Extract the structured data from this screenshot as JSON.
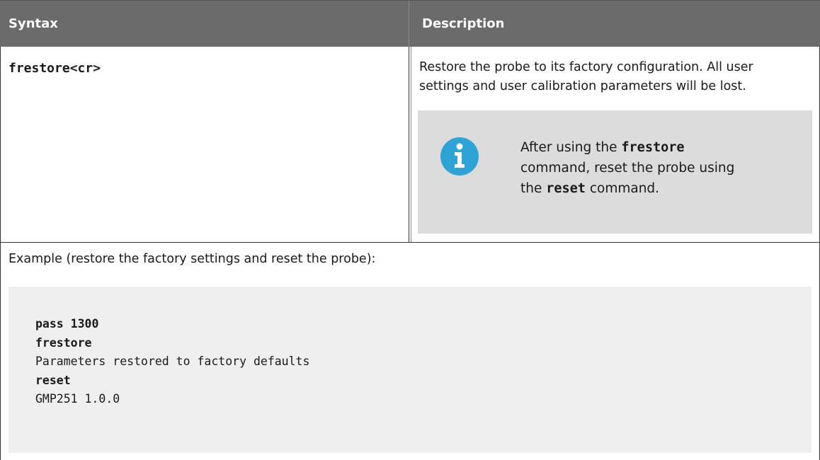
{
  "table": {
    "header": {
      "syntax": "Syntax",
      "description": "Description"
    },
    "row1": {
      "syntax_command": "frestore<cr>",
      "description_line1": "Restore the probe to its factory configuration. All user",
      "description_line2": "settings and user calibration parameters will be lost.",
      "note": {
        "icon": "info-icon",
        "line1_prefix": "After using the ",
        "line1_code": "frestore",
        "line2": "command, reset the probe using",
        "line3_prefix": "the ",
        "line3_code": "reset",
        "line3_suffix": " command."
      }
    },
    "row2": {
      "example_label": "Example (restore the factory settings and reset the probe):",
      "code_lines": [
        {
          "text": "pass 1300",
          "bold": true
        },
        {
          "text": "frestore",
          "bold": true
        },
        {
          "text": "Parameters restored to factory defaults",
          "bold": false
        },
        {
          "text": "reset",
          "bold": true
        },
        {
          "text": "GMP251 1.0.0",
          "bold": false
        }
      ]
    }
  },
  "colors": {
    "header_bg": "#6b6b6b",
    "note_bg": "#dcdcdc",
    "code_bg": "#efefef",
    "info_icon": "#2ea3d5"
  }
}
